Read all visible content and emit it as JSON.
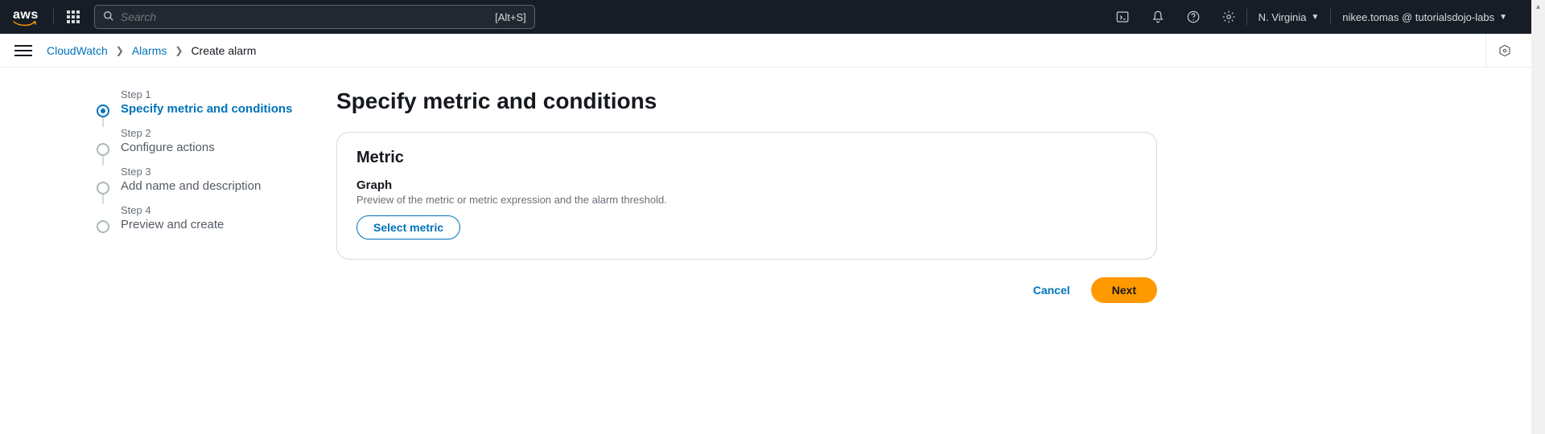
{
  "header": {
    "logo_text": "aws",
    "search_placeholder": "Search",
    "search_hint": "[Alt+S]",
    "region": "N. Virginia",
    "account": "nikee.tomas @ tutorialsdojo-labs"
  },
  "breadcrumbs": {
    "items": [
      "CloudWatch",
      "Alarms",
      "Create alarm"
    ]
  },
  "wizard": {
    "steps": [
      {
        "label": "Step 1",
        "title": "Specify metric and conditions"
      },
      {
        "label": "Step 2",
        "title": "Configure actions"
      },
      {
        "label": "Step 3",
        "title": "Add name and description"
      },
      {
        "label": "Step 4",
        "title": "Preview and create"
      }
    ]
  },
  "page": {
    "title": "Specify metric and conditions",
    "panel_title": "Metric",
    "graph_heading": "Graph",
    "graph_desc": "Preview of the metric or metric expression and the alarm threshold.",
    "select_metric": "Select metric",
    "cancel": "Cancel",
    "next": "Next"
  }
}
